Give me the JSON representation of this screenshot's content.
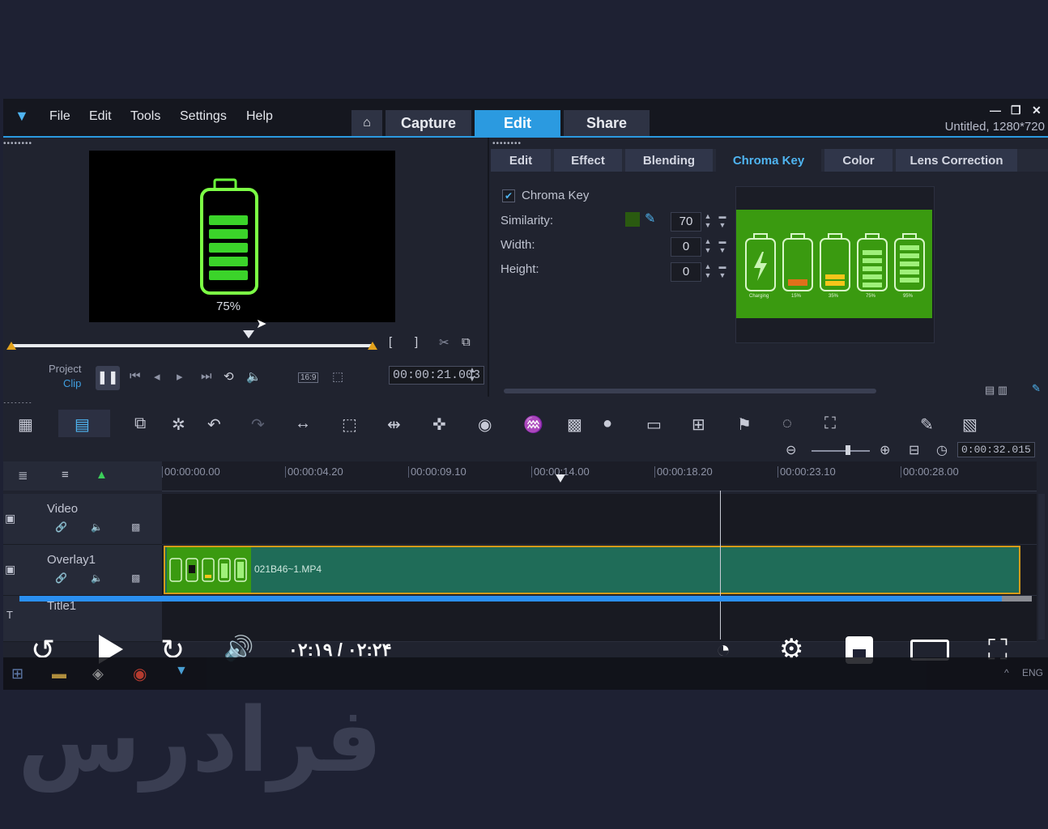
{
  "menu": {
    "file": "File",
    "edit": "Edit",
    "tools": "Tools",
    "settings": "Settings",
    "help": "Help"
  },
  "top_tabs": {
    "capture": "Capture",
    "edit": "Edit",
    "share": "Share"
  },
  "project_name": "Untitled, 1280*720",
  "preview": {
    "battery_percent": "75%",
    "mode_project": "Project",
    "mode_clip": "Clip",
    "timecode": "00:00:21.003",
    "aspect": "16:9"
  },
  "options": {
    "tabs": [
      "Edit",
      "Effect",
      "Blending",
      "Chroma Key",
      "Color",
      "Lens Correction"
    ],
    "active_tab": "Chroma Key",
    "chroma_key_label": "Chroma Key",
    "chroma_key_checked": true,
    "similarity_label": "Similarity:",
    "similarity_value": "70",
    "width_label": "Width:",
    "width_value": "0",
    "height_label": "Height:",
    "height_value": "0",
    "key_color": "#2a5a10",
    "thumb_labels": [
      "Charging",
      "15%",
      "35%",
      "75%",
      "95%"
    ]
  },
  "timeline": {
    "zoom_timecode": "0:00:32.015",
    "ruler": [
      "00:00:00.00",
      "00:00:04.20",
      "00:00:09.10",
      "00:00:14.00",
      "00:00:18.20",
      "00:00:23.10",
      "00:00:28.00"
    ],
    "tracks": {
      "video": "Video",
      "overlay": "Overlay1",
      "title": "Title1"
    },
    "clip_name": "021B46~1.MP4"
  },
  "player": {
    "time": "۰۲:۱۹ / ۰۲:۲۴",
    "progress": 0.97
  },
  "taskbar": {
    "lang": "ENG"
  },
  "watermark": "فرادرس",
  "colors": {
    "accent": "#2b9ae0",
    "clip": "#1f6c58",
    "chroma_green": "#3a9a10",
    "progress": "#2a8ff0"
  }
}
